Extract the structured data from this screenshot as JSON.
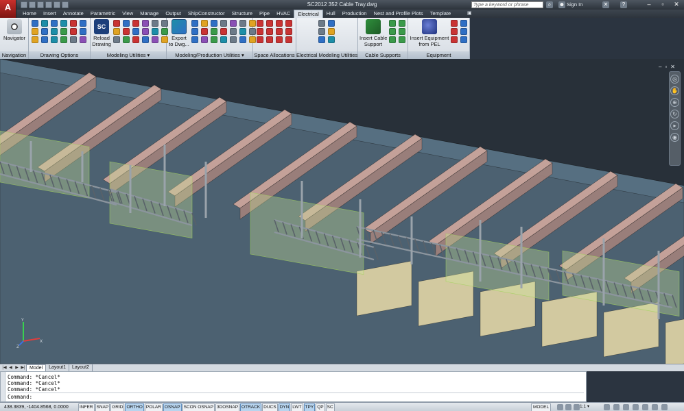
{
  "title_bar": {
    "app_logo": "A",
    "document_title": "SC2012     352 Cable Tray.dwg",
    "search_placeholder": "Type a keyword or phrase",
    "sign_in": "Sign In",
    "window_buttons": [
      "–",
      "▫",
      "✕"
    ]
  },
  "tabs": [
    "Home",
    "Insert",
    "Annotate",
    "Parametric",
    "View",
    "Manage",
    "Output",
    "ShipConstructor",
    "Structure",
    "Pipe",
    "HVAC",
    "Electrical",
    "Hull",
    "Production",
    "Nest and Profile Plots",
    "Template"
  ],
  "active_tab": "Electrical",
  "ribbon": {
    "panels": [
      {
        "label": "Navigation",
        "buttons": [
          "Navigator"
        ]
      },
      {
        "label": "Drawing Options"
      },
      {
        "label": "Modeling Utilities ▾",
        "buttons": [
          "Reload\nDrawing"
        ]
      },
      {
        "label": "Modeling/Production Utilities ▾",
        "buttons": [
          "Export\nto Dwg..."
        ]
      },
      {
        "label": "Space Allocations"
      },
      {
        "label": "Electrical Modeling Utilities"
      },
      {
        "label": "Cable Supports",
        "buttons": [
          "Insert Cable\nSupport"
        ]
      },
      {
        "label": "Equipment",
        "buttons": [
          "Insert Equipment\nfrom PEL"
        ]
      }
    ]
  },
  "viewport": {
    "controls": [
      "–",
      "▫",
      "✕"
    ],
    "colors": {
      "background": "#283039",
      "deck": "#6a8aa0",
      "beam_top": "#caa49b",
      "beam_side": "#9d807a",
      "web": "#d9cfa2",
      "tray": "#8c959e",
      "allocation": "#cde69a"
    }
  },
  "layout_tabs": [
    "Model",
    "Layout1",
    "Layout2"
  ],
  "active_layout": "Model",
  "command_history": [
    "Command: *Cancel*",
    "Command: *Cancel*",
    "Command: *Cancel*"
  ],
  "command_prompt": "Command:",
  "status_bar": {
    "coordinates": "438.3839, -1404.8568, 0.0000",
    "toggles": [
      {
        "label": "INFER",
        "on": false
      },
      {
        "label": "SNAP",
        "on": false
      },
      {
        "label": "GRID",
        "on": false
      },
      {
        "label": "ORTHO",
        "on": true
      },
      {
        "label": "POLAR",
        "on": false
      },
      {
        "label": "OSNAP",
        "on": true
      },
      {
        "label": "SCON OSNAP",
        "on": false
      },
      {
        "label": "3DOSNAP",
        "on": false
      },
      {
        "label": "OTRACK",
        "on": true
      },
      {
        "label": "DUCS",
        "on": false
      },
      {
        "label": "DYN",
        "on": true
      },
      {
        "label": "LWT",
        "on": false
      },
      {
        "label": "TPY",
        "on": true
      },
      {
        "label": "QP",
        "on": false
      },
      {
        "label": "SC",
        "on": false
      }
    ],
    "model_button": "MODEL",
    "annotation_scale": "1:1 ▾"
  }
}
